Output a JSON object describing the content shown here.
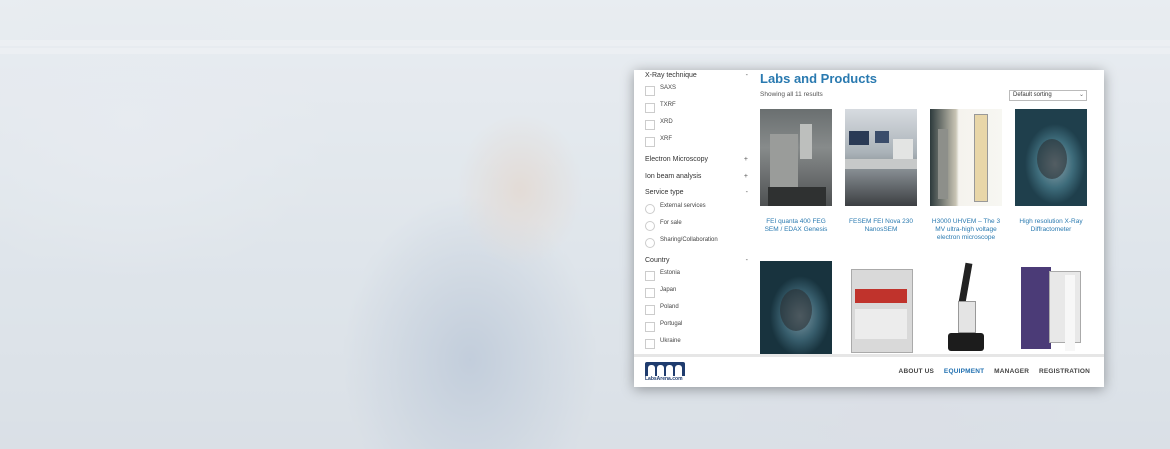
{
  "sidebar": {
    "xray_title": "X-Ray technique",
    "xray_toggle": "-",
    "xray_options": [
      "SAXS",
      "TXRF",
      "XRD",
      "XRF"
    ],
    "em_title": "Electron Microscopy",
    "em_toggle": "+",
    "ion_title": "Ion beam analysis",
    "ion_toggle": "+",
    "service_title": "Service type",
    "service_toggle": "-",
    "service_options": [
      "External services",
      "For sale",
      "Sharing/Collaboration"
    ],
    "country_title": "Country",
    "country_toggle": "-",
    "country_options": [
      "Estonia",
      "Japan",
      "Poland",
      "Portugal",
      "Ukraine"
    ]
  },
  "main": {
    "title": "Labs and Products",
    "result_count": "Showing all 11 results",
    "sort_value": "Default sorting",
    "products": [
      "FEI quanta 400 FEG SEM / EDAX Genesis",
      "FESEM FEI Nova 230 NanosSEM",
      "H3000 UHVEM – The 3 MV ultra-high voltage electron microscope",
      "High resolution X-Ray Diffractometer"
    ]
  },
  "footer": {
    "logo_text": "LabsArena.com",
    "nav": [
      "ABOUT US",
      "EQUIPMENT",
      "MANAGER",
      "REGISTRATION"
    ],
    "active": "EQUIPMENT"
  },
  "colors": {
    "accent": "#2a7ab0",
    "brand": "#1f3c6e"
  }
}
